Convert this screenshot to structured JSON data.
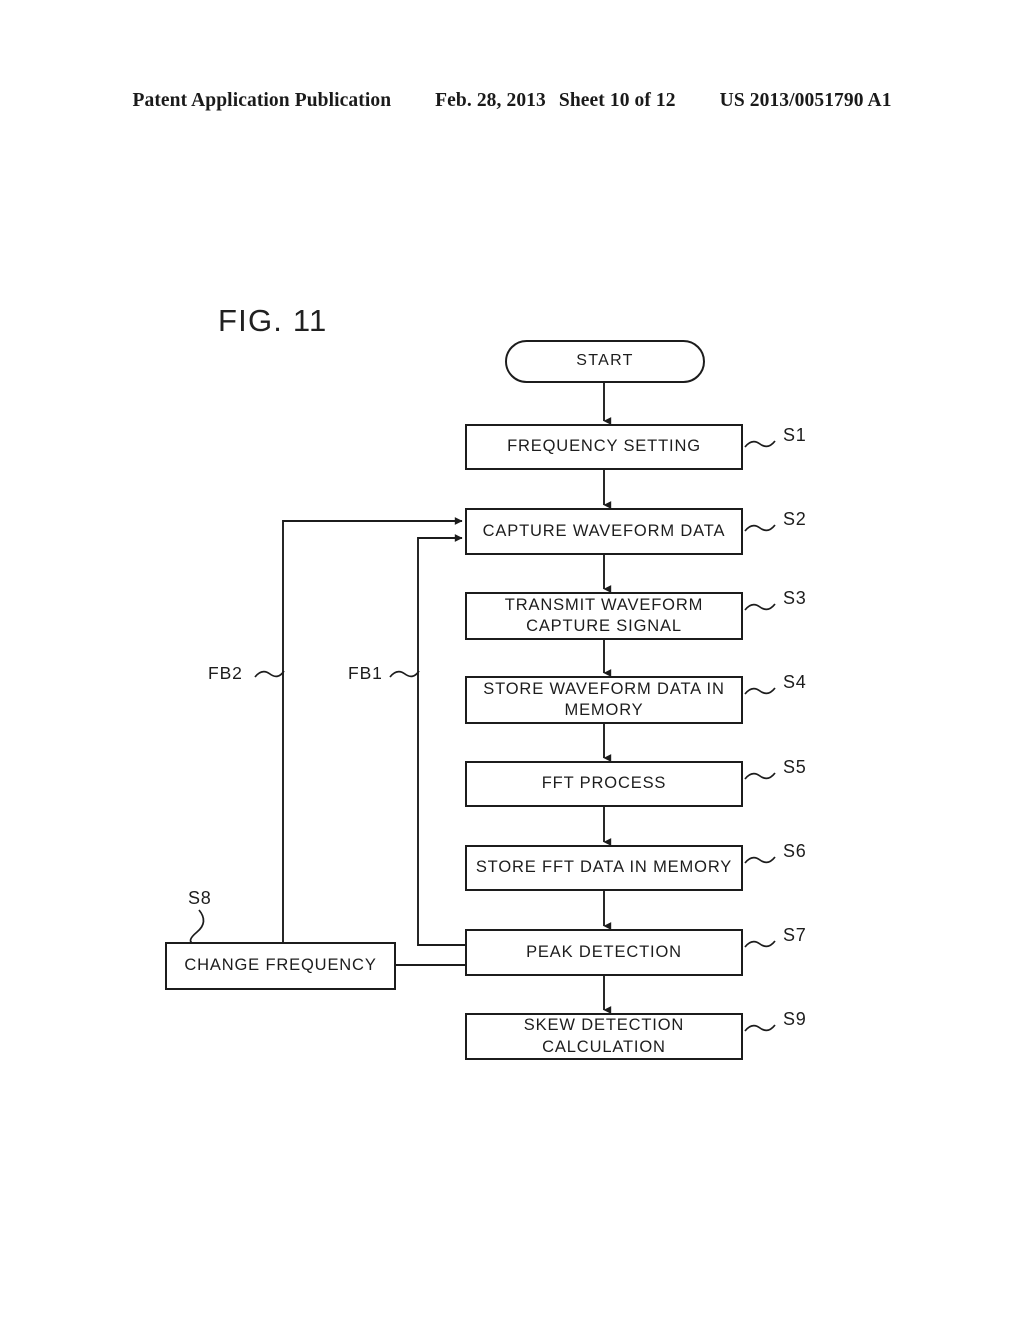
{
  "header": {
    "publication": "Patent Application Publication",
    "date": "Feb. 28, 2013",
    "sheet": "Sheet 10 of 12",
    "patent_number": "US 2013/0051790 A1"
  },
  "figure": {
    "title": "FIG. 11",
    "type": "flowchart",
    "nodes": [
      {
        "id": "start",
        "shape": "terminal",
        "text": "START",
        "ref": ""
      },
      {
        "id": "s1",
        "shape": "process",
        "text": "FREQUENCY SETTING",
        "ref": "S1"
      },
      {
        "id": "s2",
        "shape": "process",
        "text": "CAPTURE WAVEFORM DATA",
        "ref": "S2"
      },
      {
        "id": "s3",
        "shape": "process",
        "text": "TRANSMIT WAVEFORM CAPTURE SIGNAL",
        "ref": "S3"
      },
      {
        "id": "s4",
        "shape": "process",
        "text": "STORE WAVEFORM DATA IN MEMORY",
        "ref": "S4"
      },
      {
        "id": "s5",
        "shape": "process",
        "text": "FFT PROCESS",
        "ref": "S5"
      },
      {
        "id": "s6",
        "shape": "process",
        "text": "STORE FFT DATA IN MEMORY",
        "ref": "S6"
      },
      {
        "id": "s7",
        "shape": "process",
        "text": "PEAK DETECTION",
        "ref": "S7"
      },
      {
        "id": "s9",
        "shape": "process",
        "text": "SKEW DETECTION CALCULATION",
        "ref": "S9"
      },
      {
        "id": "s8",
        "shape": "process",
        "text": "CHANGE FREQUENCY",
        "ref": "S8"
      }
    ],
    "node_lines": {
      "s3": [
        "TRANSMIT WAVEFORM",
        "CAPTURE SIGNAL"
      ],
      "s4": [
        "STORE WAVEFORM DATA IN",
        "MEMORY"
      ],
      "s9": [
        "SKEW DETECTION",
        "CALCULATION"
      ]
    },
    "feedback_labels": [
      {
        "id": "fb2",
        "text": "FB2"
      },
      {
        "id": "fb1",
        "text": "FB1"
      }
    ],
    "colors": {
      "ink": "#1c1c1c",
      "paper": "#ffffff"
    }
  }
}
